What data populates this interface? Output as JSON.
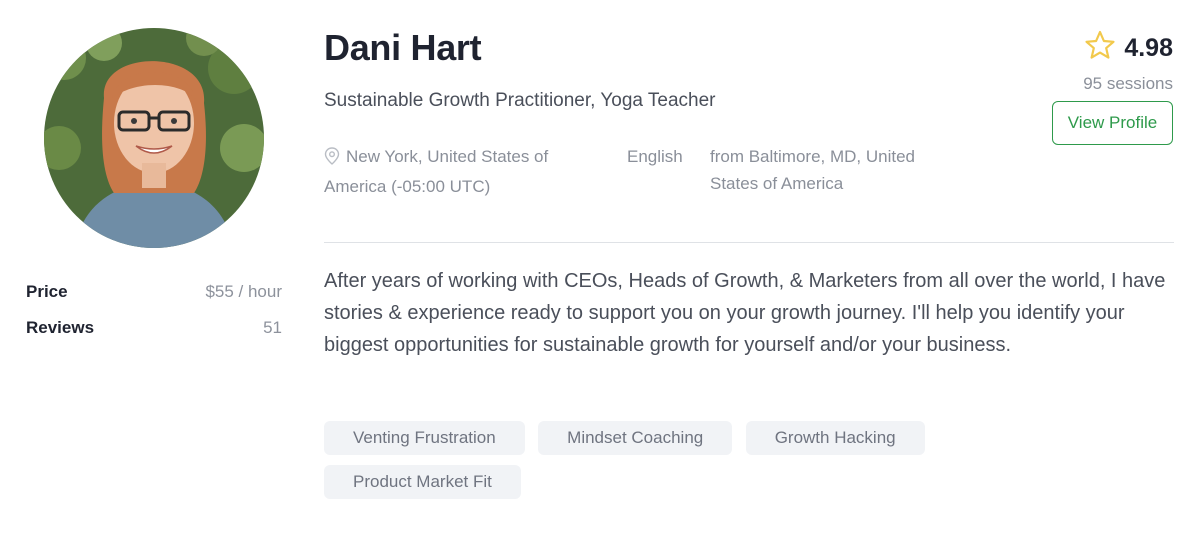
{
  "profile": {
    "name": "Dani Hart",
    "headline": "Sustainable Growth Practitioner, Yoga Teacher",
    "location": "New York, United States of America (-05:00 UTC)",
    "language": "English",
    "origin": "from Baltimore, MD, United States of America",
    "bio": "After years of working with CEOs, Heads of Growth, & Marketers from all over the world, I have stories & experience ready to support you on your growth journey. I'll help you identify your biggest opportunities for sustainable growth for yourself and/or your business.",
    "avatar_icon": "profile-photo"
  },
  "stats": {
    "price_label": "Price",
    "price_value": "$55 / hour",
    "reviews_label": "Reviews",
    "reviews_value": "51"
  },
  "rating": {
    "value": "4.98",
    "sessions": "95 sessions",
    "star_color": "#f2c94c"
  },
  "actions": {
    "view_profile_label": "View Profile",
    "accent_color": "#2e9a4b"
  },
  "tags": [
    "Venting Frustration",
    "Mindset Coaching",
    "Growth Hacking",
    "Product Market Fit"
  ]
}
